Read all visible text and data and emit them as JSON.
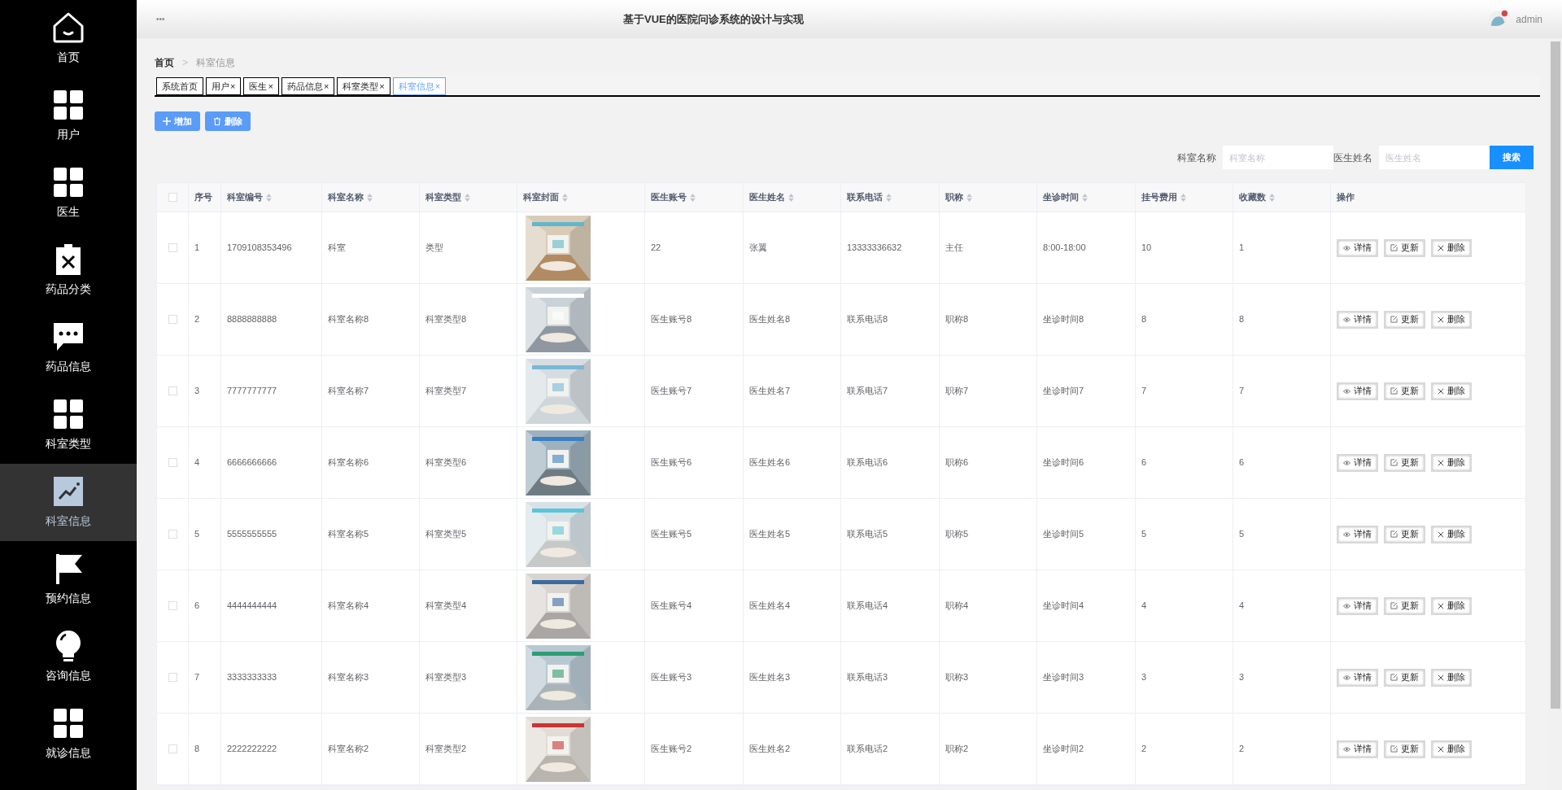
{
  "sidebar": {
    "items": [
      {
        "label": "首页",
        "selected": false
      },
      {
        "label": "用户",
        "selected": false
      },
      {
        "label": "医生",
        "selected": false
      },
      {
        "label": "药品分类",
        "selected": false
      },
      {
        "label": "药品信息",
        "selected": false
      },
      {
        "label": "科室类型",
        "selected": false
      },
      {
        "label": "科室信息",
        "selected": true
      },
      {
        "label": "预约信息",
        "selected": false
      },
      {
        "label": "咨询信息",
        "selected": false
      },
      {
        "label": "就诊信息",
        "selected": false
      }
    ]
  },
  "header": {
    "menu": "•••",
    "title": "基于VUE的医院问诊系统的设计与实现",
    "user": "admin"
  },
  "breadcrumb": {
    "items": [
      "首页",
      "科室信息"
    ],
    "separator": ">"
  },
  "tabs": [
    {
      "label": "系统首页",
      "selected": false
    },
    {
      "label": "用户",
      "close": "×",
      "selected": false
    },
    {
      "label": "医生",
      "close": "×",
      "selected": false
    },
    {
      "label": "药品信息",
      "close": "×",
      "selected": false
    },
    {
      "label": "科室类型",
      "close": "×",
      "selected": false
    },
    {
      "label": "科室信息",
      "close": "×",
      "selected": true
    }
  ],
  "toolbar": {
    "add": "增加",
    "delete": "删除"
  },
  "search": {
    "fields": [
      {
        "label": "科室名称",
        "placeholder": "科室名称"
      },
      {
        "label": "医生姓名",
        "placeholder": "医生姓名"
      }
    ],
    "button": "搜索"
  },
  "table": {
    "all_checked": false,
    "columns": [
      {
        "label": "序号",
        "sortable": false
      },
      {
        "label": "科室编号",
        "sortable": true
      },
      {
        "label": "科室名称",
        "sortable": true
      },
      {
        "label": "科室类型",
        "sortable": true
      },
      {
        "label": "科室封面",
        "sortable": true
      },
      {
        "label": "医生账号",
        "sortable": true
      },
      {
        "label": "医生姓名",
        "sortable": true
      },
      {
        "label": "联系电话",
        "sortable": true
      },
      {
        "label": "职称",
        "sortable": true
      },
      {
        "label": "坐诊时间",
        "sortable": true
      },
      {
        "label": "挂号费用",
        "sortable": true
      },
      {
        "label": "收藏数",
        "sortable": true
      },
      {
        "label": "操作",
        "sortable": false
      }
    ],
    "rows": [
      {
        "checked": false,
        "cells": [
          "1",
          "1709108353496",
          "科室",
          "类型",
          {
            "kind": "picture"
          },
          "22",
          "张翼",
          "13333336632",
          "主任",
          "8:00-18:00",
          "10",
          "1",
          {
            "kind": "actions",
            "actions": [
              "详情",
              "更新",
              "删除"
            ]
          }
        ]
      },
      {
        "checked": false,
        "cells": [
          "2",
          "8888888888",
          "科室名称8",
          "科室类型8",
          {
            "kind": "picture"
          },
          "医生账号8",
          "医生姓名8",
          "联系电话8",
          "职称8",
          "坐诊时间8",
          "8",
          "8",
          {
            "kind": "actions",
            "actions": [
              "详情",
              "更新",
              "删除"
            ]
          }
        ]
      },
      {
        "checked": false,
        "cells": [
          "3",
          "7777777777",
          "科室名称7",
          "科室类型7",
          {
            "kind": "picture"
          },
          "医生账号7",
          "医生姓名7",
          "联系电话7",
          "职称7",
          "坐诊时间7",
          "7",
          "7",
          {
            "kind": "actions",
            "actions": [
              "详情",
              "更新",
              "删除"
            ]
          }
        ]
      },
      {
        "checked": false,
        "cells": [
          "4",
          "6666666666",
          "科室名称6",
          "科室类型6",
          {
            "kind": "picture"
          },
          "医生账号6",
          "医生姓名6",
          "联系电话6",
          "职称6",
          "坐诊时间6",
          "6",
          "6",
          {
            "kind": "actions",
            "actions": [
              "详情",
              "更新",
              "删除"
            ]
          }
        ]
      },
      {
        "checked": false,
        "cells": [
          "5",
          "5555555555",
          "科室名称5",
          "科室类型5",
          {
            "kind": "picture"
          },
          "医生账号5",
          "医生姓名5",
          "联系电话5",
          "职称5",
          "坐诊时间5",
          "5",
          "5",
          {
            "kind": "actions",
            "actions": [
              "详情",
              "更新",
              "删除"
            ]
          }
        ]
      },
      {
        "checked": false,
        "cells": [
          "6",
          "4444444444",
          "科室名称4",
          "科室类型4",
          {
            "kind": "picture"
          },
          "医生账号4",
          "医生姓名4",
          "联系电话4",
          "职称4",
          "坐诊时间4",
          "4",
          "4",
          {
            "kind": "actions",
            "actions": [
              "详情",
              "更新",
              "删除"
            ]
          }
        ]
      },
      {
        "checked": false,
        "cells": [
          "7",
          "3333333333",
          "科室名称3",
          "科室类型3",
          {
            "kind": "picture"
          },
          "医生账号3",
          "医生姓名3",
          "联系电话3",
          "职称3",
          "坐诊时间3",
          "3",
          "3",
          {
            "kind": "actions",
            "actions": [
              "详情",
              "更新",
              "删除"
            ]
          }
        ]
      },
      {
        "checked": false,
        "cells": [
          "8",
          "2222222222",
          "科室名称2",
          "科室类型2",
          {
            "kind": "picture"
          },
          "医生账号2",
          "医生姓名2",
          "联系电话2",
          "职称2",
          "坐诊时间2",
          "2",
          "2",
          {
            "kind": "actions",
            "actions": [
              "详情",
              "更新",
              "删除"
            ]
          }
        ]
      }
    ]
  }
}
